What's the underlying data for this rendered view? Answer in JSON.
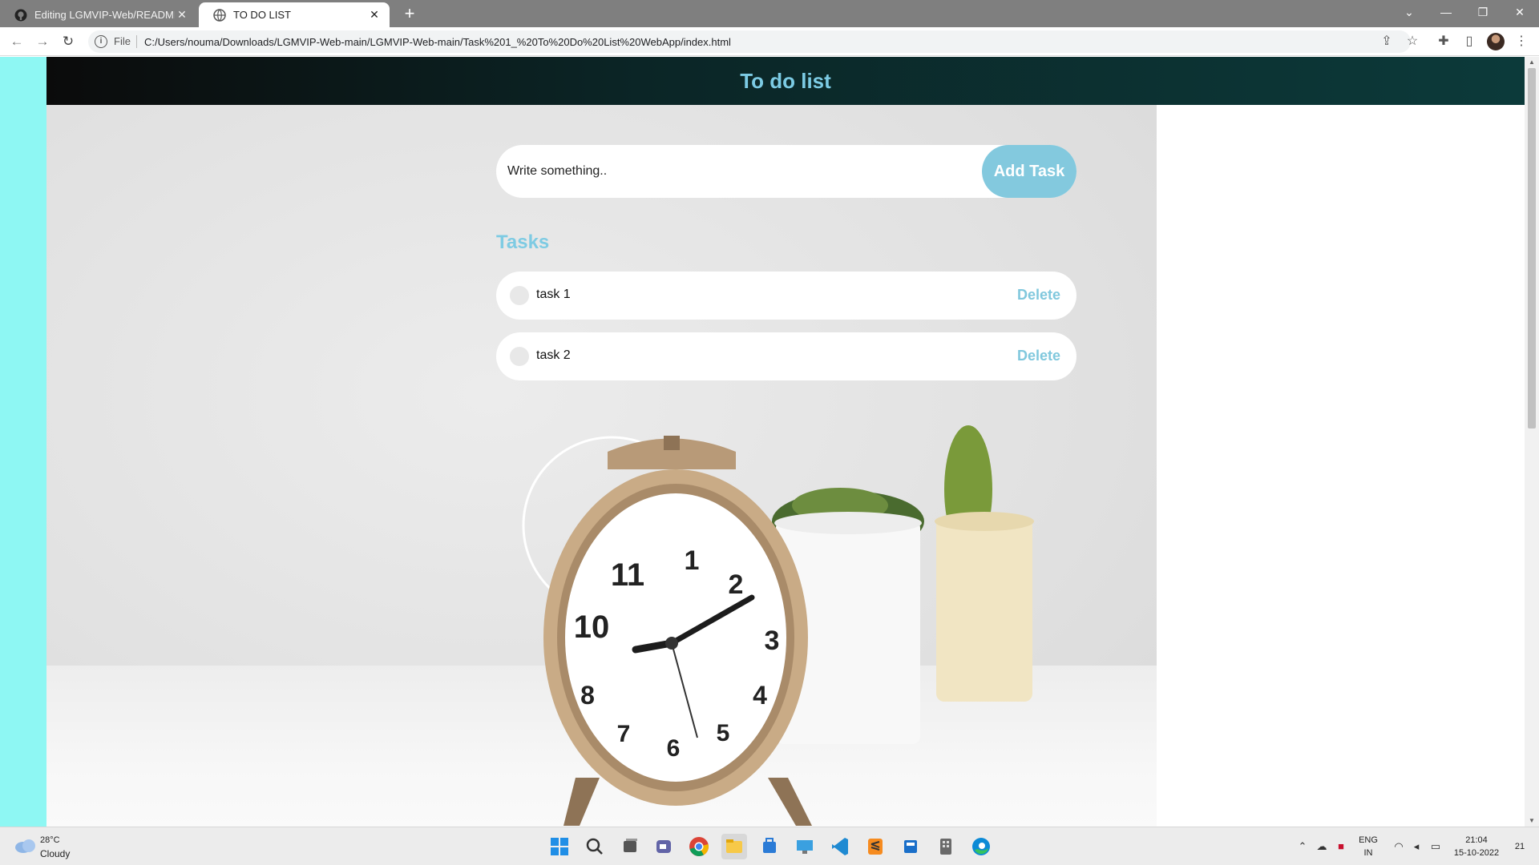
{
  "browser": {
    "tabs": [
      {
        "title": "Editing LGMVIP-Web/README.m",
        "active": false,
        "favicon": "github-icon"
      },
      {
        "title": "TO DO LIST",
        "active": true,
        "favicon": "globe-icon"
      }
    ],
    "new_tab_label": "+",
    "address_bar": {
      "scheme_label": "File",
      "url": "C:/Users/nouma/Downloads/LGMVIP-Web-main/LGMVIP-Web-main/Task%201_%20To%20Do%20List%20WebApp/index.html"
    }
  },
  "page": {
    "title": "To do list",
    "input_placeholder": "Write something..",
    "add_button_label": "Add Task",
    "tasks_heading": "Tasks",
    "tasks": [
      {
        "text": "task 1",
        "delete_label": "Delete",
        "done": false
      },
      {
        "text": "task 2",
        "delete_label": "Delete",
        "done": false
      }
    ],
    "colors": {
      "accent": "#80c8dd",
      "left_strip": "#8ef7f3",
      "header_dark": "#0b2526"
    }
  },
  "taskbar": {
    "weather": {
      "temp": "28°C",
      "desc": "Cloudy"
    },
    "apps": [
      "windows-start-icon",
      "search-icon",
      "task-view-icon",
      "teams-chat-icon",
      "chrome-icon",
      "file-explorer-icon",
      "microsoft-store-icon",
      "remote-desktop-icon",
      "vscode-icon",
      "sublime-text-icon",
      "calculator-icon",
      "edge-icon"
    ],
    "language": {
      "line1": "ENG",
      "line2": "IN"
    },
    "clock": {
      "time": "21:04",
      "date": "15-10-2022"
    },
    "notification_count": "21"
  }
}
